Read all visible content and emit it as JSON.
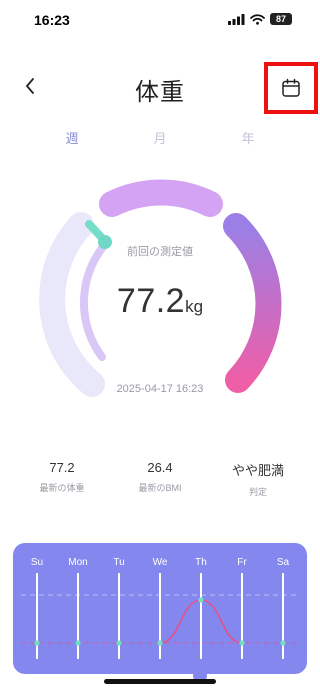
{
  "status_bar": {
    "time": "16:23",
    "battery": "87"
  },
  "header": {
    "title": "体重"
  },
  "tabs": [
    {
      "label": "週",
      "active": true
    },
    {
      "label": "月",
      "active": false
    },
    {
      "label": "年",
      "active": false
    }
  ],
  "gauge": {
    "caption": "前回の測定値",
    "value": "77.2",
    "unit": "kg",
    "datetime": "2025-04-17 16:23"
  },
  "stats": [
    {
      "value": "77.2",
      "label": "最新の体重"
    },
    {
      "value": "26.4",
      "label": "最新のBMI"
    },
    {
      "value": "やや肥満",
      "label": "判定"
    }
  ],
  "weekly": {
    "days": [
      "Su",
      "Mon",
      "Tu",
      "We",
      "Th",
      "Fr",
      "Sa"
    ],
    "values": [
      null,
      null,
      null,
      null,
      77.2,
      null,
      null
    ],
    "colors": {
      "panel": "#8488ee",
      "curve": "#e5508a",
      "point": "#6fe0c0"
    }
  },
  "colors": {
    "accent": "#8d8fd6",
    "highlight": "#ee1111"
  }
}
